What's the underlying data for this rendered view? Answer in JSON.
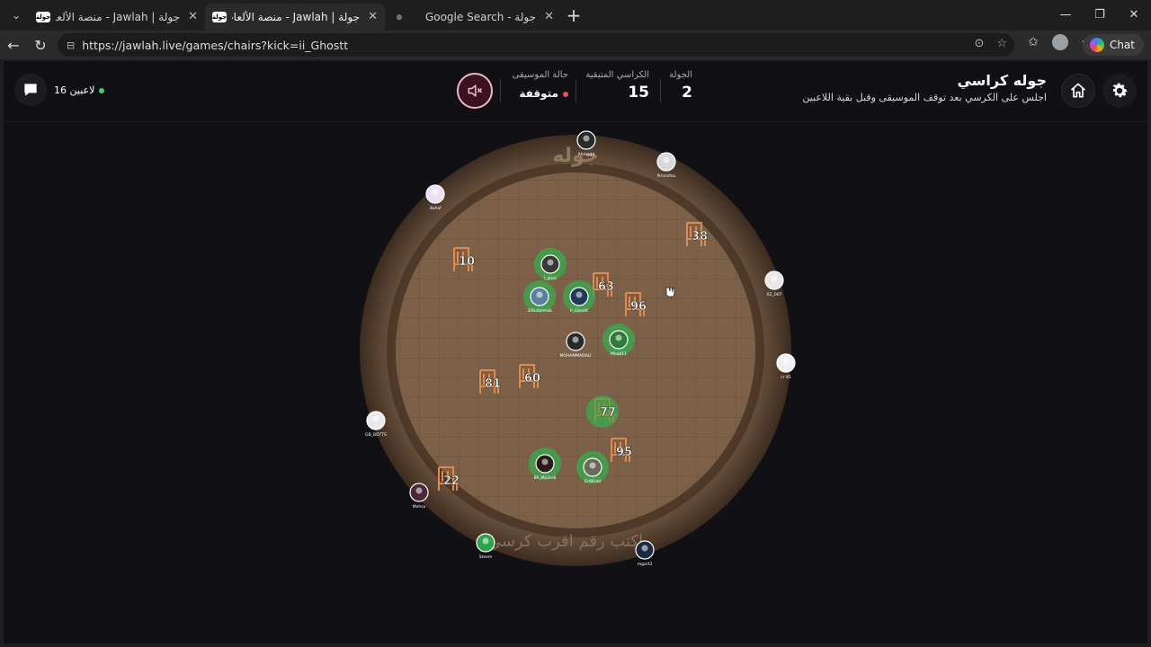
{
  "browser": {
    "tabs": [
      {
        "favicon": "جولة",
        "title": "جولة | Jawlah - منصة الألعاب التفاعلية",
        "active": false
      },
      {
        "favicon": "جولة",
        "title": "جولة | Jawlah - منصة الألعاب التفاعلية",
        "active": true
      },
      {
        "favicon": "globe-icon",
        "title": "Google Search - جولة",
        "active": false
      }
    ],
    "url": "https://jawlah.live/games/chairs?kick=ii_Ghostt",
    "chat_label": "Chat"
  },
  "header": {
    "title": "جوله كراسي",
    "subtitle": "اجلس على الكرسي بعد توقف الموسيقى وقبل بقية اللاعبين",
    "round_label": "الجولة",
    "round_value": "2",
    "chairs_label": "الكراسي المتبقية",
    "chairs_value": "15",
    "music_label": "حالة الموسيقى",
    "music_value": "متوقفة",
    "players_count": "16 لاعبين"
  },
  "board": {
    "center_watermark": "جوله",
    "hint_text": "اكتب رقم اقرب كرسي",
    "chairs": [
      {
        "num": "10",
        "taken": false
      },
      {
        "num": "38",
        "taken": false
      },
      {
        "num": "63",
        "taken": false
      },
      {
        "num": "96",
        "taken": false
      },
      {
        "num": "81",
        "taken": false
      },
      {
        "num": "60",
        "taken": false
      },
      {
        "num": "77",
        "taken": true
      },
      {
        "num": "95",
        "taken": false
      },
      {
        "num": "22",
        "taken": false
      }
    ],
    "players": [
      {
        "name": "Ahmadd",
        "seated": false
      },
      {
        "name": "Prinsxfou",
        "seated": false
      },
      {
        "name": "3bAaf",
        "seated": false
      },
      {
        "name": "XZ_007",
        "seated": false
      },
      {
        "name": "cr 85",
        "seated": false
      },
      {
        "name": "GB_BOTTS",
        "seated": false
      },
      {
        "name": "Mohsa",
        "seated": false
      },
      {
        "name": "Steem",
        "seated": false
      },
      {
        "name": "mgart3",
        "seated": false
      },
      {
        "name": "I_Jalck",
        "seated": true
      },
      {
        "name": "3iDuAshhab",
        "seated": true
      },
      {
        "name": "II_Ghostt",
        "seated": true
      },
      {
        "name": "MOHAMMADALI",
        "seated": false
      },
      {
        "name": "Mnab11",
        "seated": true
      },
      {
        "name": "BK_Mx3rob",
        "seated": true
      },
      {
        "name": "Gr8Kntd",
        "seated": true
      }
    ]
  },
  "colors": {
    "accent_green": "#3fa34d",
    "chair_orange": "#e08a4f",
    "table_wood": "#8a6a4e"
  }
}
